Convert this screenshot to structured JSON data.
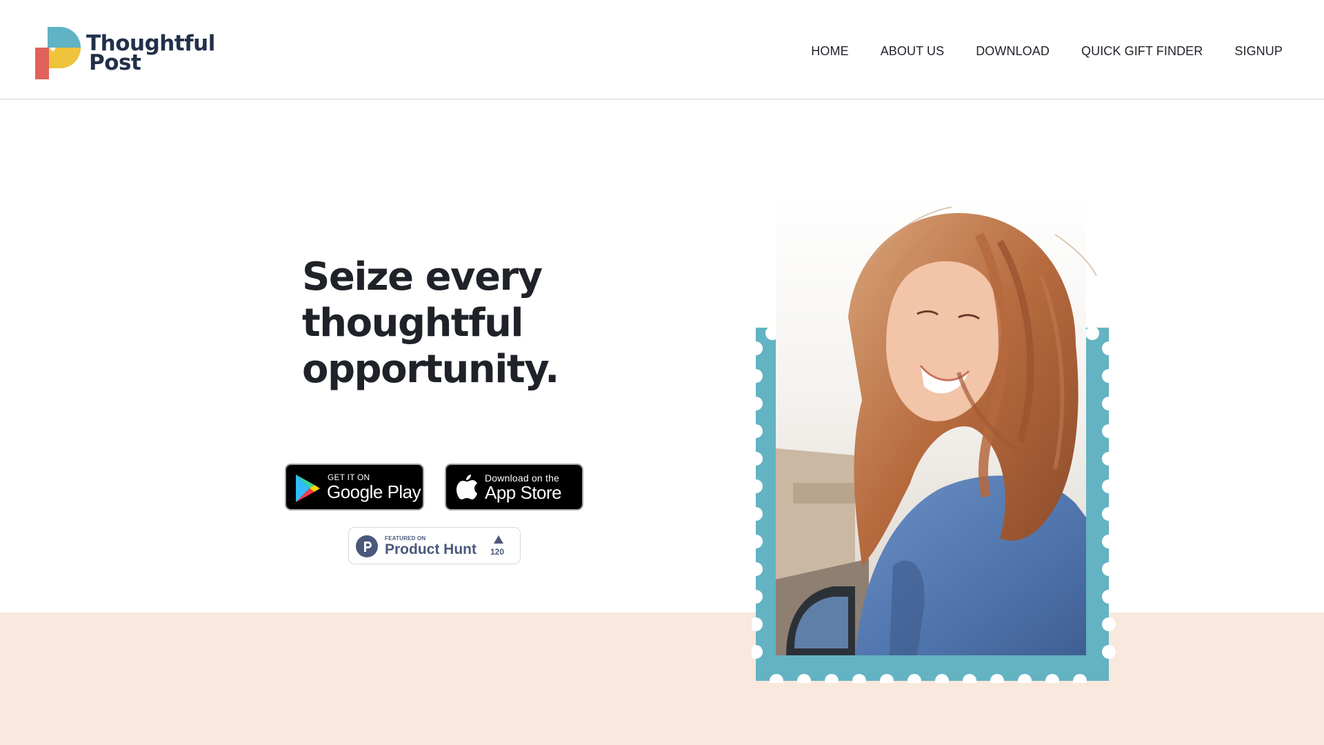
{
  "brand": {
    "name_line1": "Thoughtful",
    "name_line2": "Post",
    "colors": {
      "teal": "#5fb3c4",
      "yellow": "#f0c33c",
      "coral": "#e0625a",
      "navy": "#22304a"
    }
  },
  "nav": {
    "items": [
      {
        "label": "HOME"
      },
      {
        "label": "ABOUT US"
      },
      {
        "label": "DOWNLOAD"
      },
      {
        "label": "QUICK GIFT FINDER"
      },
      {
        "label": "SIGNUP"
      }
    ]
  },
  "hero": {
    "headline_line1": "Seize every",
    "headline_line2": "thoughtful",
    "headline_line3": "opportunity.",
    "google_play": {
      "small": "GET IT ON",
      "large": "Google Play",
      "icon": "google-play-icon"
    },
    "app_store": {
      "small": "Download on the",
      "large": "App Store",
      "icon": "apple-icon"
    },
    "product_hunt": {
      "small": "FEATURED ON",
      "large": "Product Hunt",
      "count": "120",
      "icon": "product-hunt-icon"
    },
    "photo": {
      "subject": "woman-laughing-in-denim-jacket",
      "frame": "postage-stamp",
      "frame_color": "#63b3c3"
    }
  },
  "colors": {
    "band": "#f8e8de",
    "text": "#1f2228"
  }
}
